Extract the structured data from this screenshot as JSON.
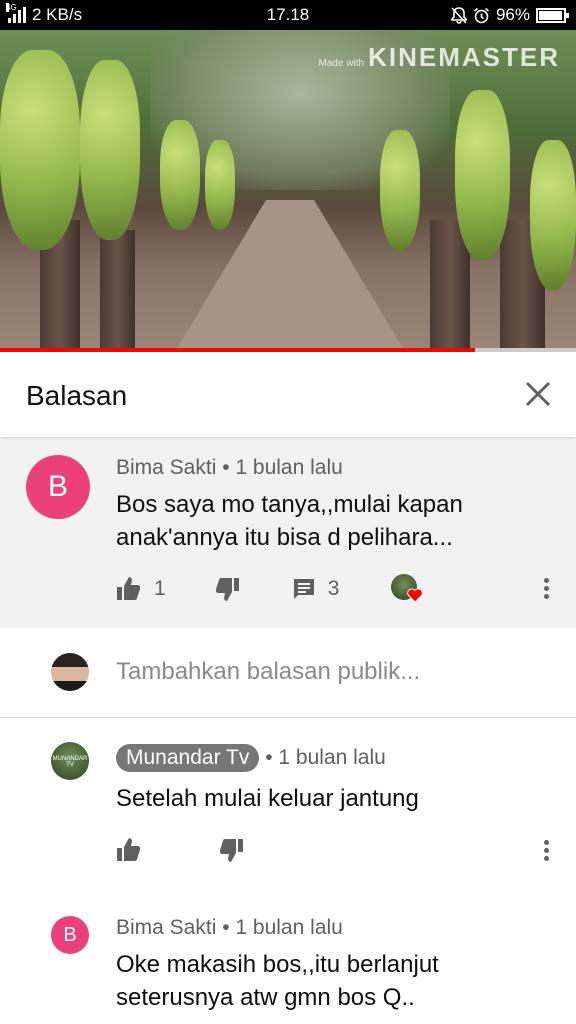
{
  "status": {
    "network": "4G",
    "speed": "2 KB/s",
    "time": "17.18",
    "battery": "96%",
    "battery_level": 0.96
  },
  "video": {
    "watermark_small": "Made with",
    "watermark": "KINEMASTER",
    "progress": 0.825
  },
  "header": {
    "title": "Balasan"
  },
  "parent_comment": {
    "avatar_letter": "B",
    "author": "Bima Sakti",
    "time": " • 1 bulan lalu",
    "text": "Bos saya mo tanya,,mulai kapan anak'annya itu bisa d pelihara...",
    "likes": "1",
    "replies": "3"
  },
  "reply_input": {
    "placeholder": "Tambahkan balasan publik..."
  },
  "replies": [
    {
      "author": "Munandar Tv",
      "time": " • 1 bulan lalu",
      "text": "Setelah mulai keluar jantung",
      "avatar_label": "MUNANDAR TV"
    },
    {
      "avatar_letter": "B",
      "author": "Bima Sakti",
      "time": " • 1 bulan lalu",
      "text": "Oke makasih bos,,itu berlanjut seterusnya atw gmn bos Q.."
    }
  ],
  "colors": {
    "accent_red": "#ff0000",
    "avatar_pink": "#ec407a",
    "meta_gray": "#606060"
  }
}
